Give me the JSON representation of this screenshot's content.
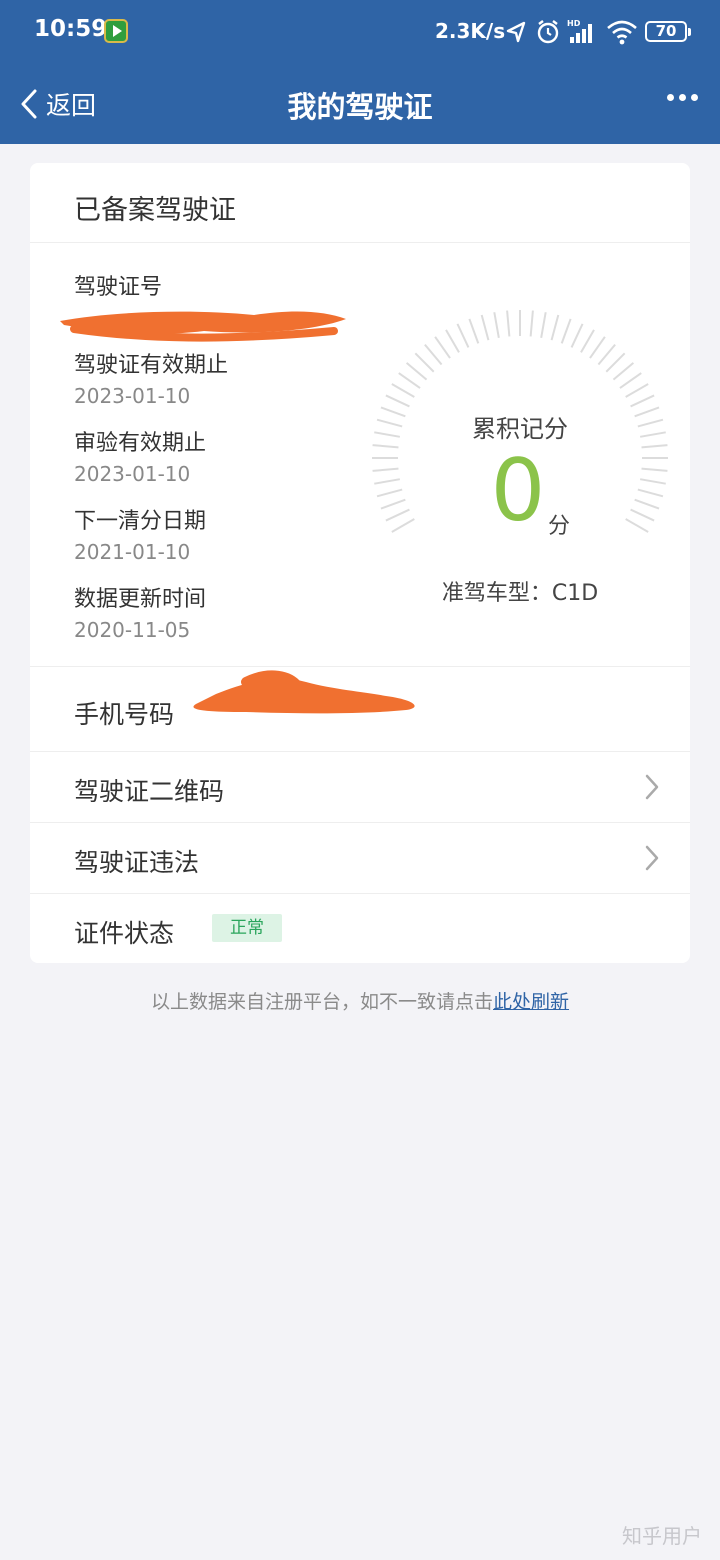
{
  "status_bar": {
    "time": "10:59",
    "network_speed": "2.3K/s",
    "battery": "70",
    "icons": [
      "app-video-icon",
      "location-arrow-icon",
      "alarm-icon",
      "hd-signal-icon",
      "wifi-icon",
      "battery-icon"
    ]
  },
  "nav": {
    "back_label": "返回",
    "title": "我的驾驶证"
  },
  "card": {
    "title": "已备案驾驶证",
    "fields": [
      {
        "label": "驾驶证号",
        "value": ""
      },
      {
        "label": "驾驶证有效期止",
        "value": "2023-01-10"
      },
      {
        "label": "审验有效期止",
        "value": "2023-01-10"
      },
      {
        "label": "下一清分日期",
        "value": "2021-01-10"
      },
      {
        "label": "数据更新时间",
        "value": "2020-11-05"
      }
    ],
    "gauge": {
      "label": "累积记分",
      "value": "0",
      "unit": "分",
      "license_type": "准驾车型：C1D",
      "value_color": "#8bc34a"
    },
    "phone_label": "手机号码",
    "qr_label": "驾驶证二维码",
    "violation_label": "驾驶证违法",
    "status_label": "证件状态",
    "status_badge": "正常"
  },
  "footnote": {
    "text": "以上数据来自注册平台，如不一致请点击",
    "link": "此处刷新"
  },
  "watermark": "知乎用户",
  "colors": {
    "header": "#2f64a6",
    "accent_green": "#8bc34a",
    "redaction": "#f07030"
  }
}
